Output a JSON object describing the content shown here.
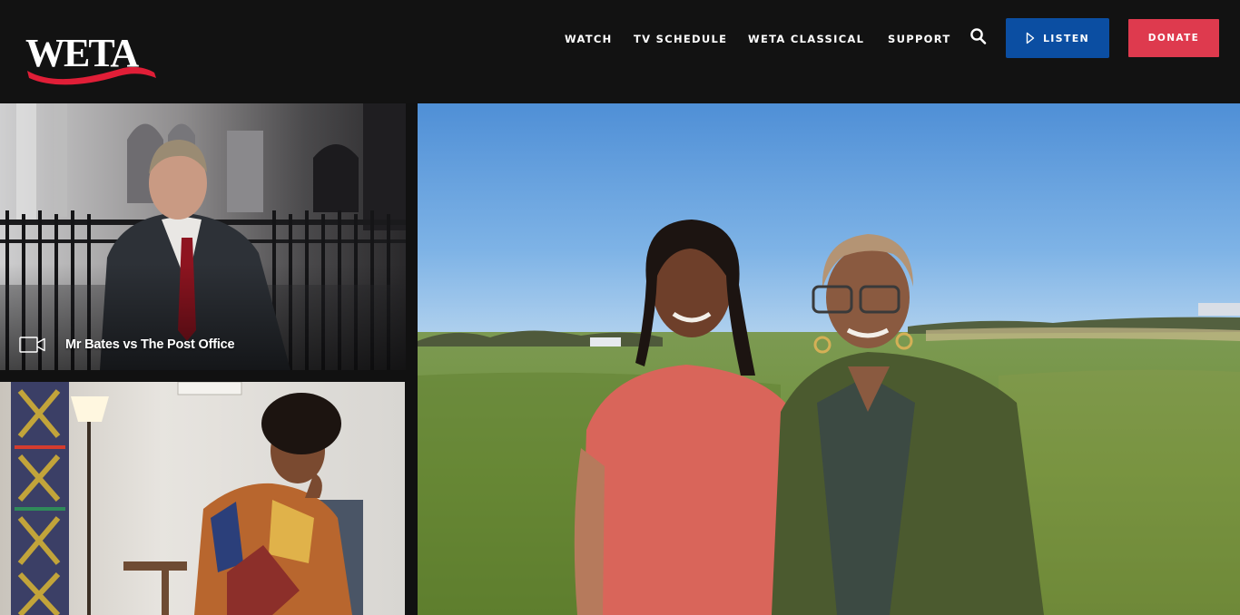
{
  "brand": {
    "logo_text": "WETA"
  },
  "nav": {
    "items": [
      {
        "label": "WATCH"
      },
      {
        "label": "TV SCHEDULE"
      },
      {
        "label": "WETA CLASSICAL"
      },
      {
        "label": "SUPPORT"
      }
    ]
  },
  "actions": {
    "listen_label": "LISTEN",
    "donate_label": "DONATE"
  },
  "colors": {
    "header_bg": "#121212",
    "listen_bg": "#0b4ea2",
    "donate_bg": "#de3a4e",
    "logo_swoosh": "#e01e37"
  },
  "icons": {
    "search": "search-icon",
    "play": "play-icon",
    "video": "video-camera-icon"
  },
  "featured": [
    {
      "title": "Mr Bates vs The Post Office",
      "media_icon": "video-camera-icon"
    }
  ]
}
